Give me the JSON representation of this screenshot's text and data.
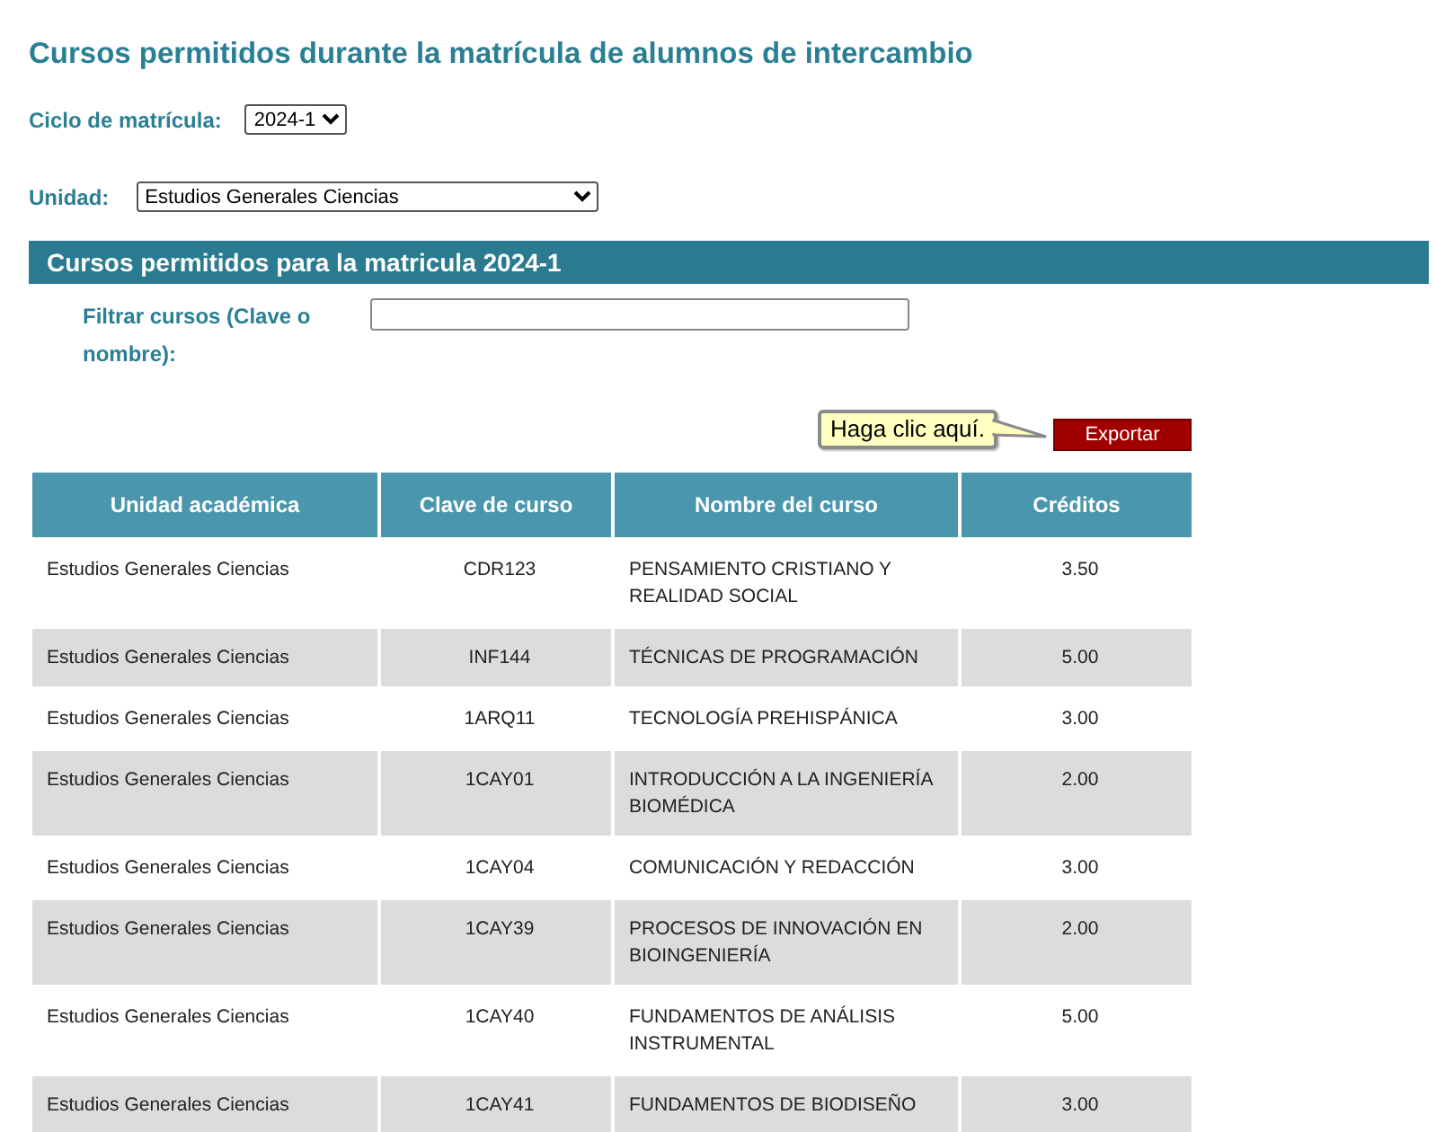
{
  "page_title": "Cursos permitidos durante la matrícula de alumnos de intercambio",
  "cycle": {
    "label": "Ciclo de matrícula:",
    "value": "2024-1"
  },
  "unit": {
    "label": "Unidad:",
    "value": "Estudios Generales Ciencias"
  },
  "section_title": "Cursos permitidos para la matricula 2024-1",
  "filter": {
    "label": "Filtrar cursos (Clave o nombre):"
  },
  "tooltip": "Haga clic aquí.",
  "export_button": "Exportar",
  "table": {
    "columns": [
      "Unidad académica",
      "Clave de curso",
      "Nombre del curso",
      "Créditos"
    ],
    "rows": [
      [
        "Estudios Generales Ciencias",
        "CDR123",
        "PENSAMIENTO CRISTIANO Y REALIDAD SOCIAL",
        "3.50"
      ],
      [
        "Estudios Generales Ciencias",
        "INF144",
        "TÉCNICAS DE PROGRAMACIÓN",
        "5.00"
      ],
      [
        "Estudios Generales Ciencias",
        "1ARQ11",
        "TECNOLOGÍA PREHISPÁNICA",
        "3.00"
      ],
      [
        "Estudios Generales Ciencias",
        "1CAY01",
        "INTRODUCCIÓN A LA INGENIERÍA BIOMÉDICA",
        "2.00"
      ],
      [
        "Estudios Generales Ciencias",
        "1CAY04",
        "COMUNICACIÓN Y REDACCIÓN",
        "3.00"
      ],
      [
        "Estudios Generales Ciencias",
        "1CAY39",
        "PROCESOS DE INNOVACIÓN EN BIOINGENIERÍA",
        "2.00"
      ],
      [
        "Estudios Generales Ciencias",
        "1CAY40",
        "FUNDAMENTOS DE ANÁLISIS INSTRUMENTAL",
        "5.00"
      ],
      [
        "Estudios Generales Ciencias",
        "1CAY41",
        "FUNDAMENTOS DE BIODISEÑO",
        "3.00"
      ]
    ]
  }
}
